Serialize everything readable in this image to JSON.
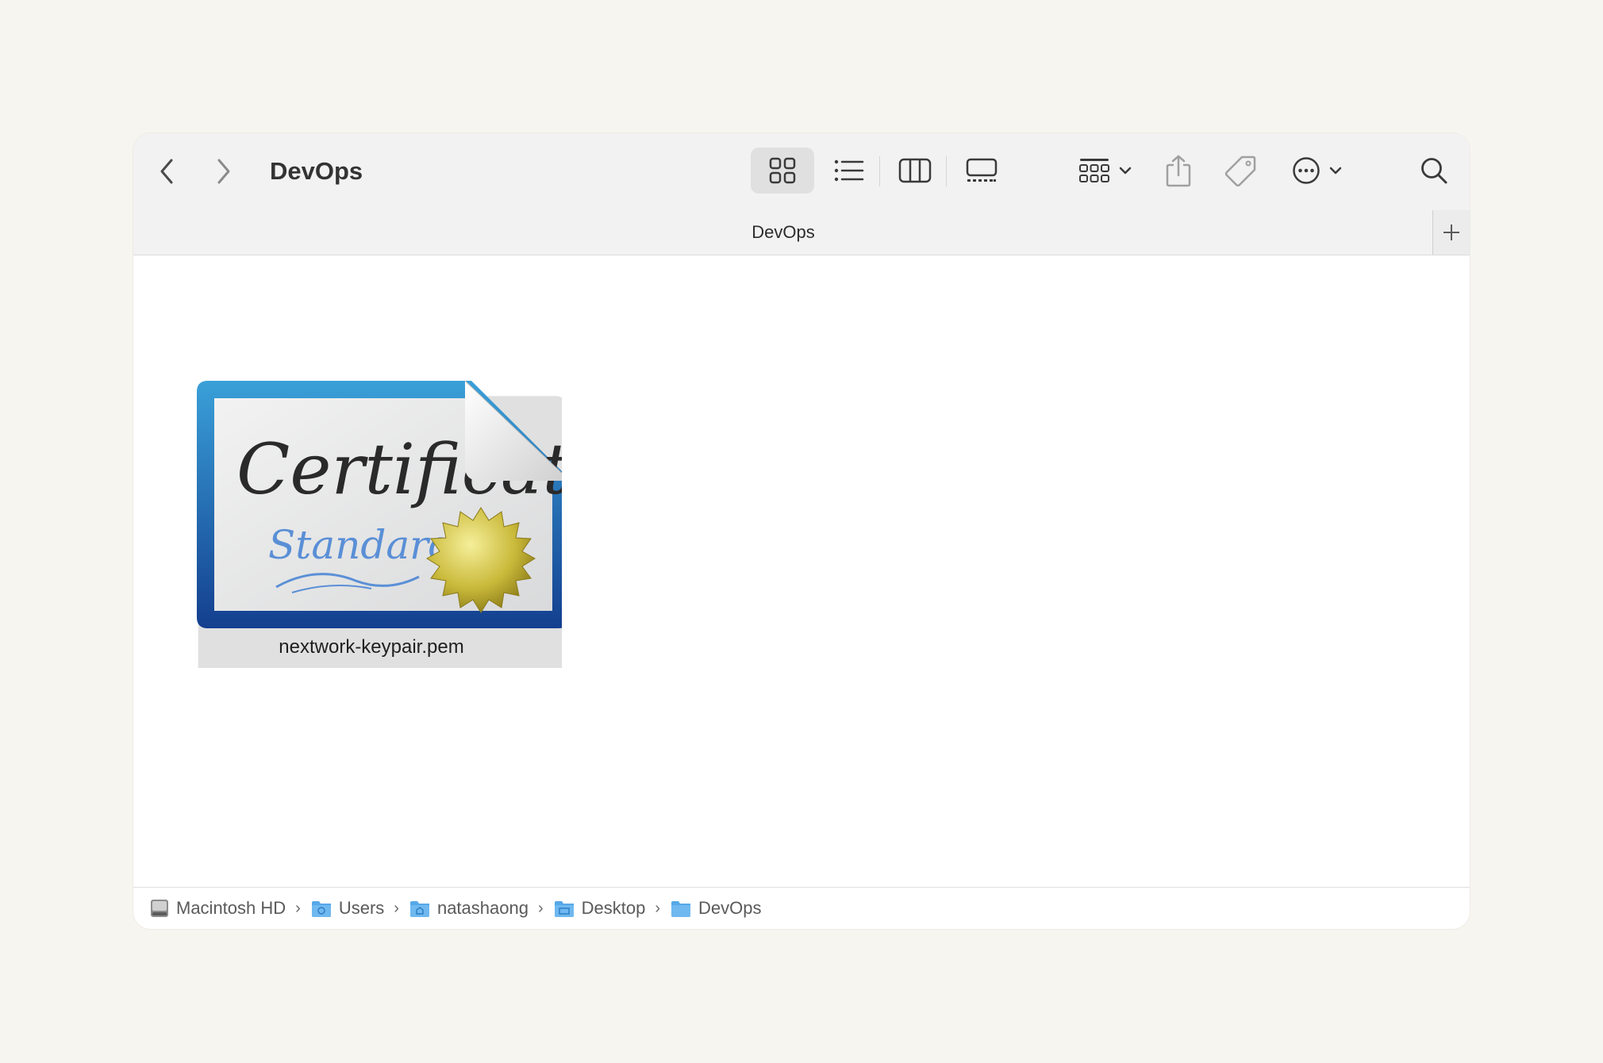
{
  "window": {
    "title": "DevOps"
  },
  "toolbar": {
    "back_icon": "chevron-left-icon",
    "forward_icon": "chevron-right-icon",
    "views": [
      {
        "name": "icon-view",
        "selected": true
      },
      {
        "name": "list-view",
        "selected": false
      },
      {
        "name": "column-view",
        "selected": false
      },
      {
        "name": "gallery-view",
        "selected": false
      }
    ],
    "group_icon": "group-by-icon",
    "share_icon": "share-icon",
    "tag_icon": "tag-icon",
    "more_icon": "ellipsis-circle-icon",
    "search_icon": "search-icon"
  },
  "tabbar": {
    "tab_label": "DevOps",
    "add_label": "+"
  },
  "files": [
    {
      "name": "nextwork-keypair.pem",
      "icon": "certificate-icon",
      "icon_text_1": "Certificate",
      "icon_text_2": "Standard"
    }
  ],
  "pathbar": {
    "items": [
      {
        "label": "Macintosh HD",
        "icon": "hard-drive-icon"
      },
      {
        "label": "Users",
        "icon": "users-folder-icon"
      },
      {
        "label": "natashaong",
        "icon": "home-folder-icon"
      },
      {
        "label": "Desktop",
        "icon": "desktop-folder-icon"
      },
      {
        "label": "DevOps",
        "icon": "folder-icon"
      }
    ],
    "separator": "›"
  },
  "colors": {
    "accent_folder": "#56a8e8",
    "cert_border": "#1a5ba8",
    "seal": "#c9b93a",
    "background": "#f7f5f0"
  }
}
